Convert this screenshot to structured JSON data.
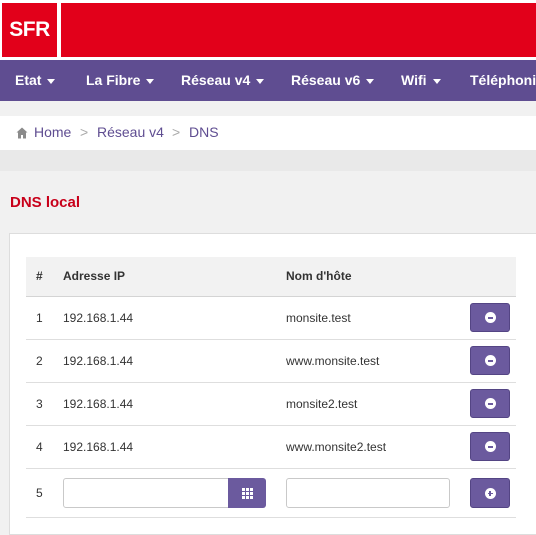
{
  "brand": {
    "logo_text": "SFR",
    "color": "#e2001a"
  },
  "nav": {
    "items": [
      {
        "label": "Etat"
      },
      {
        "label": "La Fibre"
      },
      {
        "label": "Réseau v4"
      },
      {
        "label": "Réseau v6"
      },
      {
        "label": "Wifi"
      },
      {
        "label": "Téléphonie"
      }
    ],
    "color": "#5f4d91"
  },
  "breadcrumb": {
    "home": "Home",
    "separator": ">",
    "level1": "Réseau v4",
    "level2": "DNS"
  },
  "section": {
    "title": "DNS local"
  },
  "table": {
    "headers": {
      "index": "#",
      "ip": "Adresse IP",
      "hostname": "Nom d'hôte"
    },
    "rows": [
      {
        "index": "1",
        "ip": "192.168.1.44",
        "hostname": "monsite.test"
      },
      {
        "index": "2",
        "ip": "192.168.1.44",
        "hostname": "www.monsite.test"
      },
      {
        "index": "3",
        "ip": "192.168.1.44",
        "hostname": "monsite2.test"
      },
      {
        "index": "4",
        "ip": "192.168.1.44",
        "hostname": "www.monsite2.test"
      }
    ],
    "new_row": {
      "index": "5",
      "ip_value": "",
      "hostname_value": ""
    }
  },
  "icons": {
    "remove": "minus-circle-icon",
    "add": "plus-circle-icon",
    "picker": "grid-icon",
    "home": "home-icon"
  }
}
